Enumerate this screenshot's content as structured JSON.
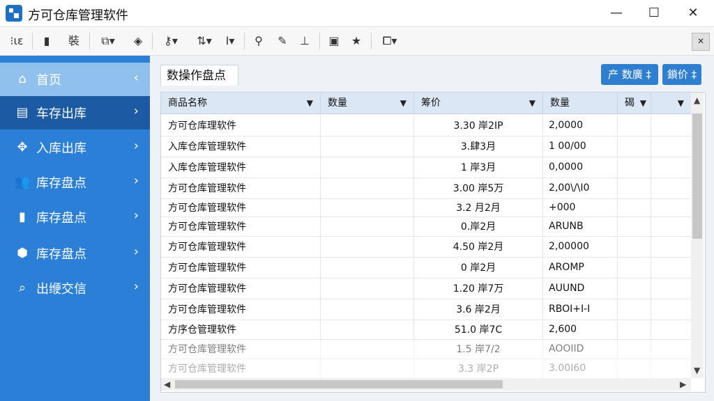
{
  "window": {
    "title": "方可仓库管理软件"
  },
  "toolbar": {
    "text_button": "裝"
  },
  "sidebar": {
    "items": [
      {
        "label": "首页",
        "icon": "home-icon"
      },
      {
        "label": "车存出库",
        "icon": "boxes-icon"
      },
      {
        "label": "入库出库",
        "icon": "grid-icon"
      },
      {
        "label": "库存盘点",
        "icon": "person-icon"
      },
      {
        "label": "库存盘点",
        "icon": "file-icon"
      },
      {
        "label": "库存盘点",
        "icon": "box-icon"
      },
      {
        "label": "出缏交信",
        "icon": "search-icon"
      }
    ]
  },
  "main": {
    "tab_label": "数操作盘点",
    "buttons": {
      "data_sort": "产 数廣 ‡",
      "price": "鎖价 ‡"
    }
  },
  "table": {
    "columns": [
      "商品名称",
      "数量",
      "筹价",
      "数量",
      "碣",
      ""
    ],
    "rows": [
      [
        "方可仓库理软件",
        "",
        "3.30 岸2IP",
        "2,0000",
        "",
        ""
      ],
      [
        "入库仓库管理软件",
        "",
        "3.肆3月",
        "1 00/00",
        "",
        ""
      ],
      [
        "入库仓库管理软件",
        "",
        "1 岸3月",
        "0,0000",
        "",
        ""
      ],
      [
        "方可仓库管理软件",
        "",
        "3.00 岸5万",
        "2,00\\/\\I0",
        "",
        ""
      ],
      [
        "方可仓库管理软件",
        "",
        "3.2 月2月",
        "+000",
        "",
        ""
      ],
      [
        "方可仓库管理软件",
        "",
        "0.岸2月",
        "ARUNB",
        "",
        ""
      ],
      [
        "方可仓库管理软件",
        "",
        "4.50 岸2月",
        "2,00000",
        "",
        ""
      ],
      [
        "方可仓库管理软件",
        "",
        "0 岸2月",
        "AROMP",
        "",
        ""
      ],
      [
        "方可仓库管理软件",
        "",
        "1.20 岸7万",
        "AUUND",
        "",
        ""
      ],
      [
        "方可仓库管理软件",
        "",
        "3.6 岸2月",
        "RBOI+I-I",
        "",
        ""
      ],
      [
        "方序仓管理软件",
        "",
        "51.0 岸7C",
        "2,600",
        "",
        ""
      ],
      [
        "方可仓库管理软件",
        "",
        "1.5 岸7/2",
        "AOOIID",
        "",
        ""
      ],
      [
        "方可仓库管理软件",
        "",
        "3.3 岸2P",
        "3.00I60",
        "",
        ""
      ]
    ]
  }
}
